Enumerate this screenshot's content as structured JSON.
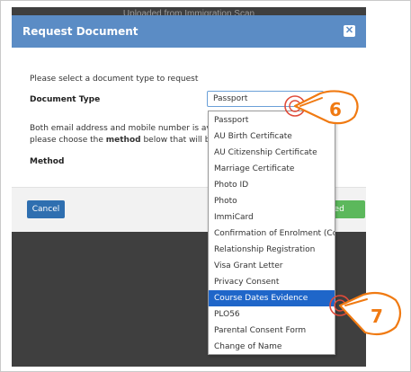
{
  "background": {
    "title_text": "Uploaded from Immigration Scan"
  },
  "modal": {
    "title": "Request Document",
    "close_label": "✕",
    "instruction": "Please select a document type to request",
    "document_type_label": "Document Type",
    "selected_value": "Passport",
    "info_line1": "Both email address and mobile number is availabl",
    "info_line2": "please choose the",
    "info_method_word": "method",
    "info_line2_end": "below that will be use",
    "method_label": "Method",
    "cancel_label": "Cancel",
    "proceed_label": "eed"
  },
  "dropdown": {
    "options": [
      "Passport",
      "AU Birth Certificate",
      "AU Citizenship Certificate",
      "Marriage Certificate",
      "Photo ID",
      "Photo",
      "ImmiCard",
      "Confirmation of Enrolment (CoE)",
      "Relationship Registration",
      "Visa Grant Letter",
      "Privacy Consent",
      "Course Dates Evidence",
      "PLO56",
      "Parental Consent Form",
      "Change of Name"
    ],
    "selected_index": 11
  },
  "markers": {
    "step6": "6",
    "step7": "7",
    "accent_color": "#f07a12"
  }
}
